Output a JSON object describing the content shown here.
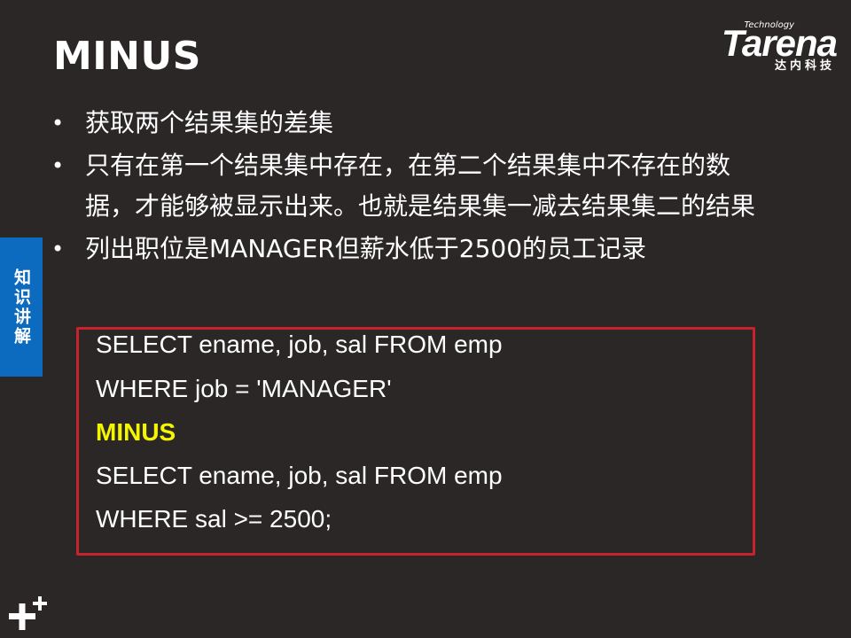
{
  "slide": {
    "title": "MINUS",
    "side_tab": "知识讲解"
  },
  "logo": {
    "technology": "Technology",
    "brand": "Tarena",
    "subtitle": "达内科技"
  },
  "bullets": [
    "获取两个结果集的差集",
    "只有在第一个结果集中存在，在第二个结果集中不存在的数据，才能够被显示出来。也就是结果集一减去结果集二的结果",
    "列出职位是MANAGER但薪水低于2500的员工记录"
  ],
  "code": [
    "SELECT ename, job, sal FROM emp",
    "WHERE job = 'MANAGER'",
    "MINUS",
    "SELECT ename, job, sal FROM emp",
    "WHERE sal >= 2500;"
  ],
  "colors": {
    "background": "#2b2727",
    "text": "#ffffff",
    "highlight": "#f5f500",
    "frame": "#c8222c",
    "side_tab": "#0d6bbf"
  },
  "icons": {
    "bottom_left": "plus-plus-icon",
    "bullet": "bullet-dot-icon"
  }
}
